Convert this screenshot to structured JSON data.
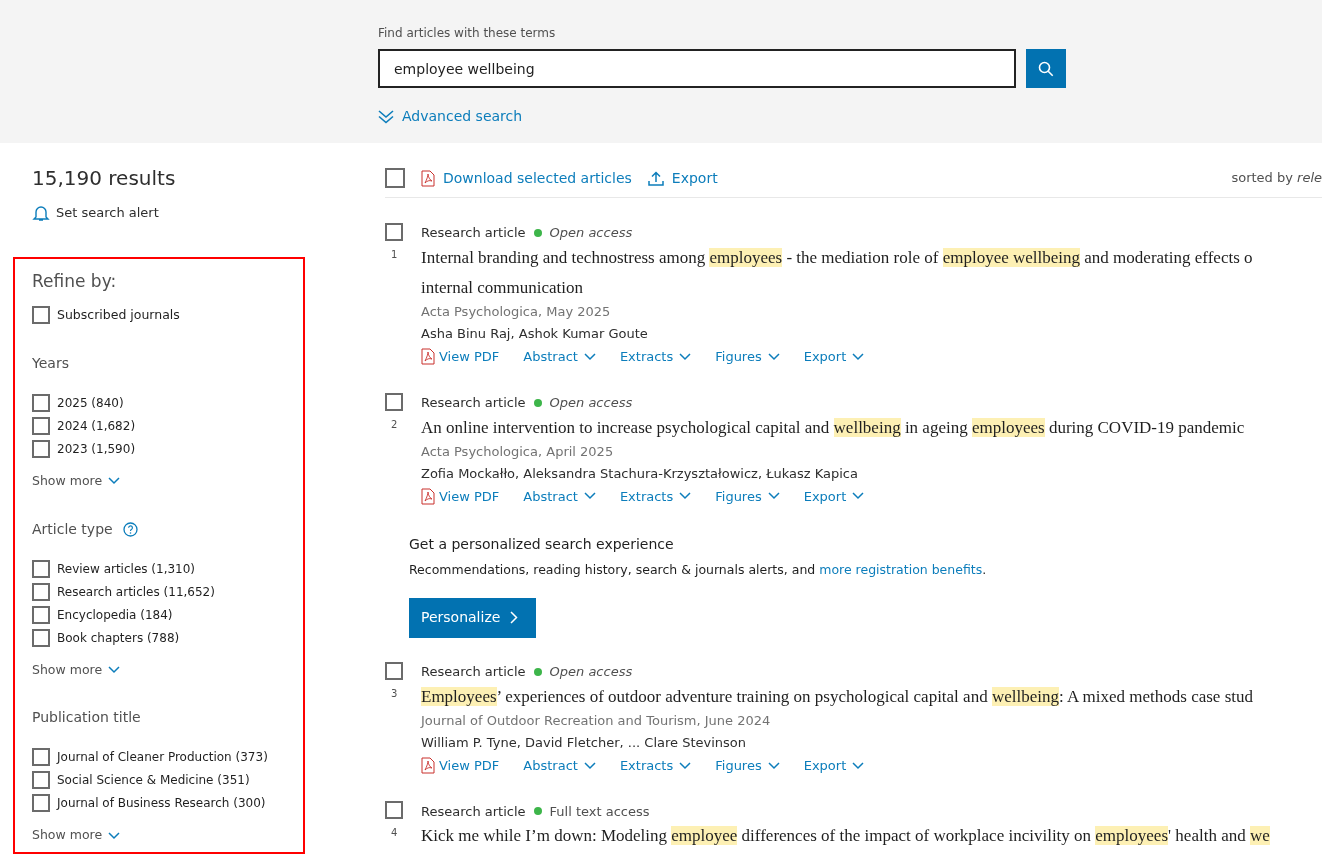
{
  "search": {
    "label": "Find articles with these terms",
    "value": "employee wellbeing",
    "advanced": "Advanced search"
  },
  "results_count": "15,190 results",
  "alert": "Set search alert",
  "filters": {
    "title": "Refine by:",
    "subscribed": {
      "label": "Subscribed journals",
      "checked": false
    },
    "groups": [
      {
        "title": "Years",
        "items": [
          {
            "label": "2025 (840)",
            "checked": false
          },
          {
            "label": "2024 (1,682)",
            "checked": false
          },
          {
            "label": "2023 (1,590)",
            "checked": false
          }
        ],
        "show_more": "Show more"
      },
      {
        "title": "Article type",
        "info": true,
        "items": [
          {
            "label": "Review articles (1,310)",
            "checked": false
          },
          {
            "label": "Research articles (11,652)",
            "checked": false
          },
          {
            "label": "Encyclopedia (184)",
            "checked": false
          },
          {
            "label": "Book chapters (788)",
            "checked": false
          }
        ],
        "show_more": "Show more"
      },
      {
        "title": "Publication title",
        "items": [
          {
            "label": "Journal of Cleaner Production (373)",
            "checked": false
          },
          {
            "label": "Social Science & Medicine (351)",
            "checked": false
          },
          {
            "label": "Journal of Business Research (300)",
            "checked": false
          }
        ],
        "show_more": "Show more"
      }
    ]
  },
  "toolbar": {
    "select_all_checked": false,
    "download": "Download selected articles",
    "export": "Export",
    "sort": "sorted by *rele*"
  },
  "results": [
    {
      "kind": "article",
      "checked": false,
      "number": "1",
      "type": "Research article",
      "access": "Open access",
      "access_italic": true,
      "color": "#3db54a",
      "title_lines": [
        [
          {
            "text": "Internal branding and technostress among ",
            "highlight": false
          },
          {
            "text": "employees",
            "highlight": true
          },
          {
            "text": " - the mediation role of ",
            "highlight": false
          },
          {
            "text": "employee ",
            "highlight": true
          },
          {
            "text": "wellbeing",
            "highlight": true
          },
          {
            "text": " and moderating effects o",
            "highlight": false
          }
        ],
        [
          {
            "text": "internal communication",
            "highlight": false
          }
        ]
      ],
      "journal": "Acta Psychologica, May 2025",
      "authors": "Asha Binu Raj, Ashok Kumar Goute",
      "actions": [
        {
          "kind": "pdf",
          "label": "View PDF"
        },
        {
          "kind": "menu",
          "label": "Abstract"
        },
        {
          "kind": "menu",
          "label": "Extracts"
        },
        {
          "kind": "menu",
          "label": "Figures"
        },
        {
          "kind": "menu",
          "label": "Export"
        }
      ]
    },
    {
      "kind": "article",
      "checked": false,
      "number": "2",
      "type": "Research article",
      "access": "Open access",
      "access_italic": true,
      "color": "#3db54a",
      "title_lines": [
        [
          {
            "text": "An online intervention to increase psychological capital and ",
            "highlight": false
          },
          {
            "text": "wellbeing",
            "highlight": true
          },
          {
            "text": " in ageing ",
            "highlight": false
          },
          {
            "text": "employees",
            "highlight": true
          },
          {
            "text": " during COVID-19 pandemic",
            "highlight": false
          }
        ]
      ],
      "journal": "Acta Psychologica, April 2025",
      "authors": "Zofia Mockałło, Aleksandra Stachura-Krzyształowicz, Łukasz Kapica",
      "actions": [
        {
          "kind": "pdf",
          "label": "View PDF"
        },
        {
          "kind": "menu",
          "label": "Abstract"
        },
        {
          "kind": "menu",
          "label": "Extracts"
        },
        {
          "kind": "menu",
          "label": "Figures"
        },
        {
          "kind": "menu",
          "label": "Export"
        }
      ]
    },
    {
      "kind": "promo",
      "heading": "Get a personalized search experience",
      "text": "Recommendations, reading history, search & journals alerts, and ",
      "link": "more registration benefits",
      "after": ".",
      "button": "Personalize"
    },
    {
      "kind": "article",
      "checked": false,
      "number": "3",
      "type": "Research article",
      "access": "Open access",
      "access_italic": true,
      "color": "#3db54a",
      "title_lines": [
        [
          {
            "text": "Employees",
            "highlight": true
          },
          {
            "text": "’ experiences of outdoor adventure training on psychological capital and ",
            "highlight": false
          },
          {
            "text": "wellbeing",
            "highlight": true
          },
          {
            "text": ": A mixed methods case stud",
            "highlight": false
          }
        ]
      ],
      "journal": "Journal of Outdoor Recreation and Tourism, June 2024",
      "authors": "William P. Tyne, David Fletcher, ... Clare Stevinson",
      "actions": [
        {
          "kind": "pdf",
          "label": "View PDF"
        },
        {
          "kind": "menu",
          "label": "Abstract"
        },
        {
          "kind": "menu",
          "label": "Extracts"
        },
        {
          "kind": "menu",
          "label": "Figures"
        },
        {
          "kind": "menu",
          "label": "Export"
        }
      ]
    },
    {
      "kind": "article",
      "checked": false,
      "number": "4",
      "type": "Research article",
      "access": "Full text access",
      "access_italic": false,
      "color": "#3db54a",
      "title_lines": [
        [
          {
            "text": "Kick me while I’m down: Modeling ",
            "highlight": false
          },
          {
            "text": "employee",
            "highlight": true
          },
          {
            "text": " differences of the impact of workplace incivility on ",
            "highlight": false
          },
          {
            "text": "employees",
            "highlight": true
          },
          {
            "text": "' health and ",
            "highlight": false
          },
          {
            "text": "we",
            "highlight": true
          }
        ]
      ]
    }
  ]
}
